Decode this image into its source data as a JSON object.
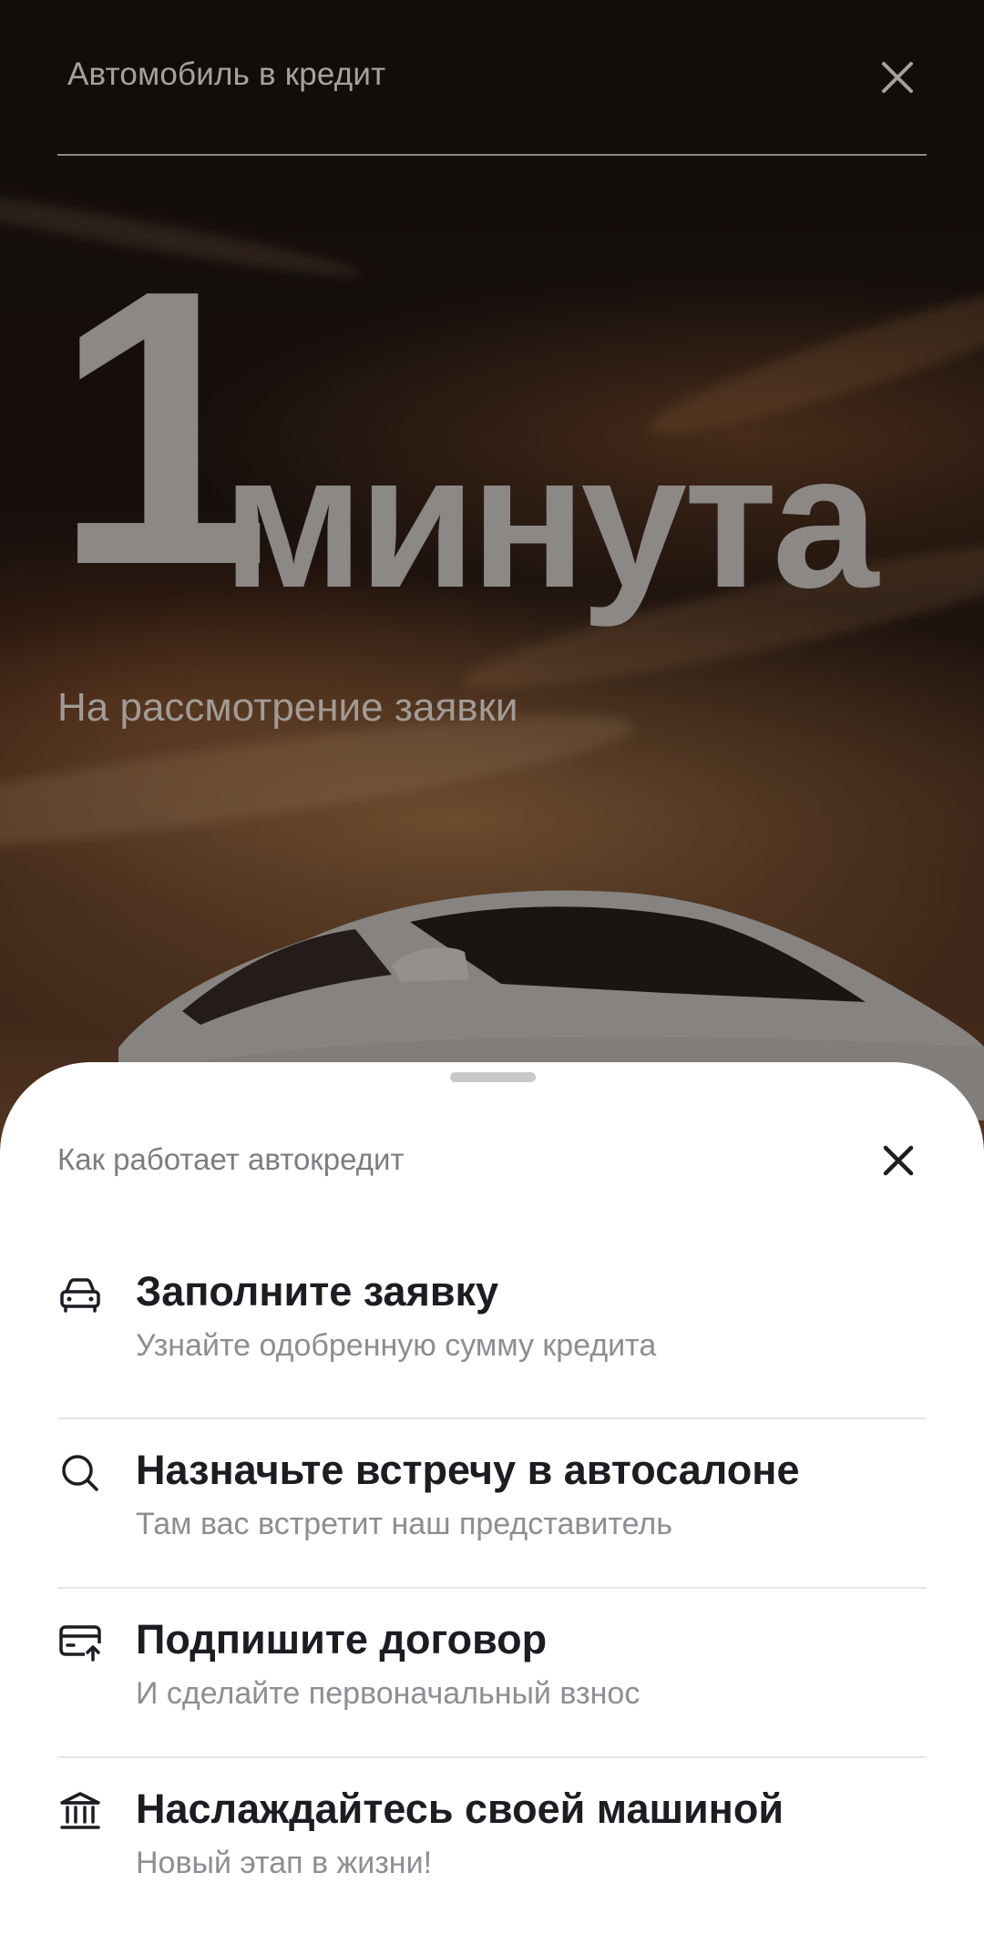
{
  "header": {
    "title": "Автомобиль в кредит",
    "close_icon": "close-icon"
  },
  "hero": {
    "number": "1",
    "unit": "минута",
    "subtitle": "На рассмотрение заявки"
  },
  "sheet": {
    "title": "Как работает автокредит",
    "close_icon": "close-icon",
    "steps": [
      {
        "icon": "car-icon",
        "title": "Заполните заявку",
        "description": "Узнайте одобренную сумму кредита"
      },
      {
        "icon": "search-icon",
        "title": "Назначьте встречу в автосалоне",
        "description": "Там вас встретит наш представитель"
      },
      {
        "icon": "card-payment-icon",
        "title": "Подпишите договор",
        "description": "И сделайте первоначальный взнос"
      },
      {
        "icon": "bank-icon",
        "title": "Наслаждайтесь своей машиной",
        "description": "Новый этап в жизни!"
      }
    ]
  },
  "colors": {
    "sheet_background": "#ffffff",
    "title_text": "#1c1c22",
    "secondary_text": "#8d8d93"
  }
}
